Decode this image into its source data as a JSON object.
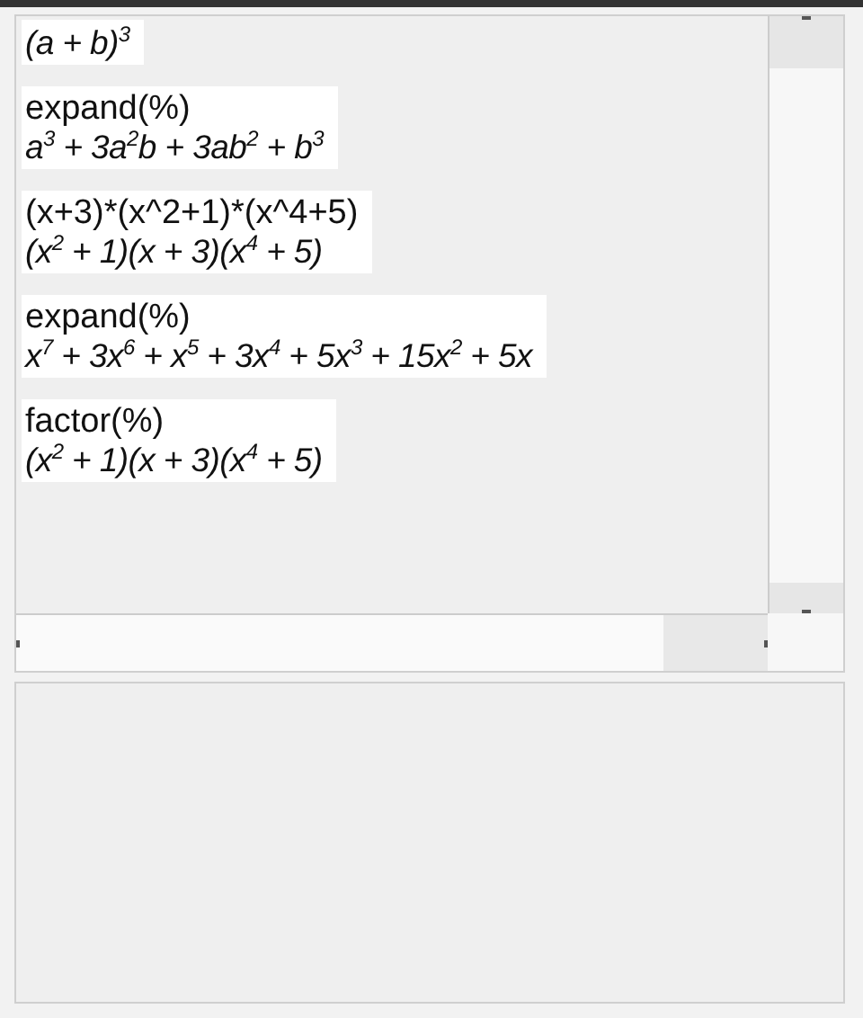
{
  "history": [
    {
      "lines": [
        {
          "kind": "output",
          "text": "(a + b)$^{3}$"
        }
      ]
    },
    {
      "lines": [
        {
          "kind": "input",
          "text": "expand(%)"
        },
        {
          "kind": "output",
          "text": "a$^{3}$ + 3a$^{2}$b + 3ab$^{2}$ + b$^{3}$"
        }
      ]
    },
    {
      "lines": [
        {
          "kind": "input",
          "text": "(x+3)*(x^2+1)*(x^4+5)"
        },
        {
          "kind": "output",
          "text": "(x$^{2}$ + 1)(x + 3)(x$^{4}$ + 5)"
        }
      ]
    },
    {
      "lines": [
        {
          "kind": "input",
          "text": "expand(%)"
        },
        {
          "kind": "output",
          "text": "x$^{7}$ + 3x$^{6}$ + x$^{5}$ + 3x$^{4}$ + 5x$^{3}$ + 15x$^{2}$ + 5x"
        }
      ]
    },
    {
      "lines": [
        {
          "kind": "input",
          "text": "factor(%)"
        },
        {
          "kind": "output",
          "text": "(x$^{2}$ + 1)(x + 3)(x$^{4}$ + 5)"
        }
      ]
    }
  ]
}
